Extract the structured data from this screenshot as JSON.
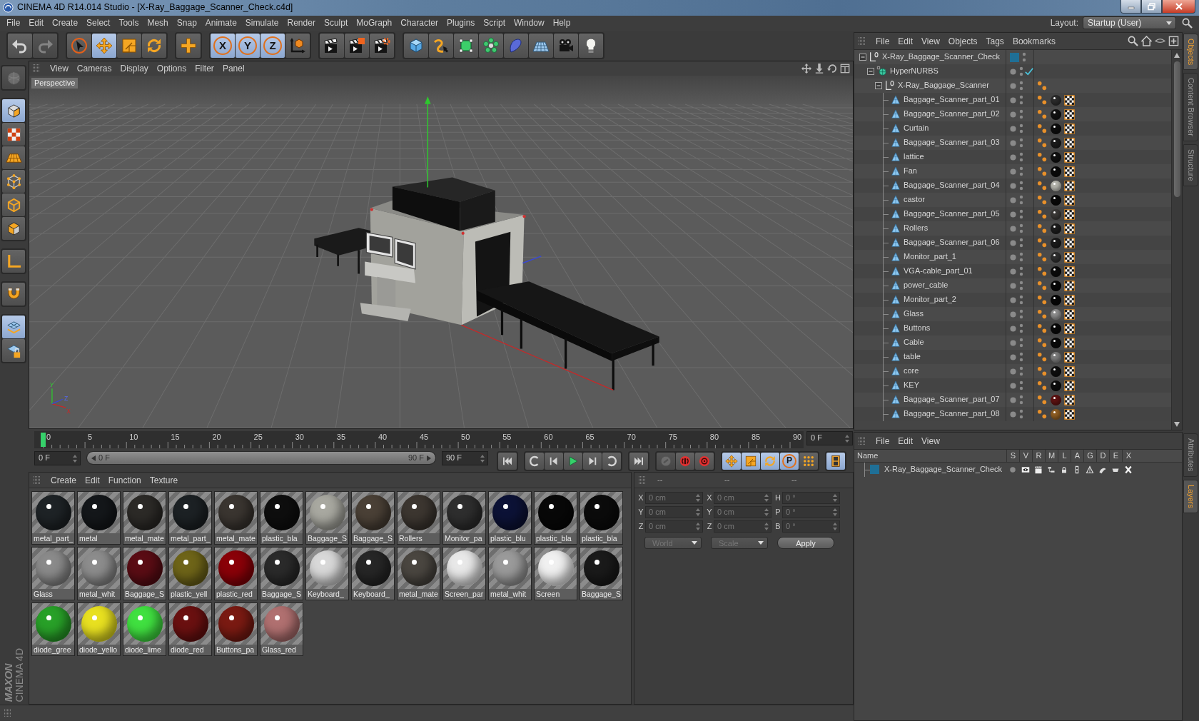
{
  "window": {
    "title": "CINEMA 4D R14.014 Studio - [X-Ray_Baggage_Scanner_Check.c4d]"
  },
  "menu": [
    "File",
    "Edit",
    "Create",
    "Select",
    "Tools",
    "Mesh",
    "Snap",
    "Animate",
    "Simulate",
    "Render",
    "Sculpt",
    "MoGraph",
    "Character",
    "Plugins",
    "Script",
    "Window",
    "Help"
  ],
  "layout": {
    "label": "Layout:",
    "value": "Startup (User)"
  },
  "toolbar": [
    [
      {
        "kind": "undo",
        "selected": false,
        "disabled": false
      },
      {
        "kind": "redo",
        "selected": false,
        "disabled": true
      }
    ],
    [
      {
        "kind": "select",
        "selected": false,
        "disabled": false
      },
      {
        "kind": "move",
        "selected": true,
        "disabled": false
      },
      {
        "kind": "scale",
        "selected": false,
        "disabled": false
      },
      {
        "kind": "rotate",
        "selected": false,
        "disabled": false
      }
    ],
    [
      {
        "kind": "add",
        "selected": false,
        "disabled": false
      }
    ],
    [
      {
        "kind": "axis",
        "label": "X",
        "selected": true,
        "disabled": false
      },
      {
        "kind": "axis",
        "label": "Y",
        "selected": true,
        "disabled": false
      },
      {
        "kind": "axis",
        "label": "Z",
        "selected": true,
        "disabled": false
      },
      {
        "kind": "coordsys",
        "selected": false,
        "disabled": false
      }
    ],
    [
      {
        "kind": "rview",
        "selected": false,
        "disabled": false
      },
      {
        "kind": "rpv",
        "selected": false,
        "disabled": false
      },
      {
        "kind": "rset",
        "selected": false,
        "disabled": false
      }
    ],
    [
      {
        "kind": "cube",
        "selected": false,
        "disabled": false
      },
      {
        "kind": "spline",
        "selected": false,
        "disabled": false
      },
      {
        "kind": "nurbs",
        "selected": false,
        "disabled": false
      },
      {
        "kind": "array",
        "selected": false,
        "disabled": false
      },
      {
        "kind": "deformer",
        "selected": false,
        "disabled": false
      },
      {
        "kind": "floor",
        "selected": false,
        "disabled": false
      },
      {
        "kind": "camera",
        "selected": false,
        "disabled": false
      },
      {
        "kind": "light",
        "selected": false,
        "disabled": false
      }
    ]
  ],
  "left_tools": [
    [
      {
        "kind": "model",
        "selected": false,
        "disabled": true
      }
    ],
    [
      {
        "kind": "object",
        "selected": true,
        "disabled": false
      },
      {
        "kind": "texture",
        "selected": false,
        "disabled": false
      },
      {
        "kind": "workplane",
        "selected": false,
        "disabled": false
      },
      {
        "kind": "points",
        "selected": false,
        "disabled": false
      },
      {
        "kind": "edges",
        "selected": false,
        "disabled": false
      },
      {
        "kind": "polygons",
        "selected": false,
        "disabled": false
      }
    ],
    [
      {
        "kind": "axismode",
        "selected": false,
        "disabled": false
      }
    ],
    [
      {
        "kind": "tweak",
        "selected": false,
        "disabled": false
      }
    ],
    [
      {
        "kind": "wgrid",
        "selected": true,
        "disabled": false
      },
      {
        "kind": "glock",
        "selected": false,
        "disabled": false
      }
    ]
  ],
  "viewport": {
    "menu": [
      "View",
      "Cameras",
      "Display",
      "Options",
      "Filter",
      "Panel"
    ],
    "view_name": "Perspective",
    "axis_labels": [
      "Y",
      "X",
      "Z"
    ]
  },
  "timeline": {
    "frames": [
      "0",
      "5",
      "10",
      "15",
      "20",
      "25",
      "30",
      "35",
      "40",
      "45",
      "50",
      "55",
      "60",
      "65",
      "70",
      "75",
      "80",
      "85",
      "90"
    ],
    "playhead": {
      "level": 0
    },
    "current": "0 F"
  },
  "transport": {
    "start": "0 F",
    "range": {
      "start": "0 F",
      "end": "90 F",
      "level": 1
    },
    "end": "90 F",
    "buttons": [
      [
        {
          "kind": "first",
          "selected": false,
          "disabled": false
        }
      ],
      [
        {
          "kind": "prevkey",
          "selected": false,
          "disabled": false
        },
        {
          "kind": "prevframe",
          "selected": false,
          "disabled": false
        },
        {
          "kind": "play",
          "selected": false,
          "disabled": false
        },
        {
          "kind": "nextframe",
          "selected": false,
          "disabled": false
        },
        {
          "kind": "nextkey",
          "selected": false,
          "disabled": false
        }
      ],
      [
        {
          "kind": "last",
          "selected": false,
          "disabled": false
        }
      ],
      [
        {
          "kind": "recoff",
          "selected": false,
          "disabled": true
        },
        {
          "kind": "record",
          "selected": false,
          "disabled": false
        },
        {
          "kind": "autokey",
          "selected": false,
          "disabled": false
        }
      ],
      [
        {
          "kind": "kmove",
          "selected": true,
          "disabled": false
        },
        {
          "kind": "kscale",
          "selected": true,
          "disabled": false
        },
        {
          "kind": "krot",
          "selected": true,
          "disabled": false
        },
        {
          "kind": "param",
          "label": "P",
          "selected": true,
          "disabled": false
        },
        {
          "kind": "pla",
          "selected": false,
          "disabled": false
        }
      ],
      [
        {
          "kind": "timeline",
          "selected": true,
          "disabled": false
        }
      ]
    ]
  },
  "materials": {
    "menu": [
      "Create",
      "Edit",
      "Function",
      "Texture"
    ],
    "items": [
      {
        "name": "metal_part_",
        "color": "#1e2326"
      },
      {
        "name": "metal",
        "color": "#14171a"
      },
      {
        "name": "metal_mate",
        "color": "#2c2a27"
      },
      {
        "name": "metal_part_",
        "color": "#1c2124"
      },
      {
        "name": "metal_mate",
        "color": "#3a3530"
      },
      {
        "name": "plastic_bla",
        "color": "#0e0e0e"
      },
      {
        "name": "Baggage_S",
        "color": "#a8a8a0"
      },
      {
        "name": "Baggage_S",
        "color": "#4a4036"
      },
      {
        "name": "Rollers",
        "color": "#3c3630"
      },
      {
        "name": "Monitor_pa",
        "color": "#2e2e2e"
      },
      {
        "name": "plastic_blu",
        "color": "#0c1236"
      },
      {
        "name": "plastic_bla",
        "color": "#080808"
      },
      {
        "name": "plastic_bla",
        "color": "#0b0b0b"
      },
      {
        "name": "Glass",
        "color": "#8a8a8a"
      },
      {
        "name": "metal_whit",
        "color": "#8c8c8c"
      },
      {
        "name": "Baggage_S",
        "color": "#5a0c14"
      },
      {
        "name": "plastic_yell",
        "color": "#6e6418"
      },
      {
        "name": "plastic_red",
        "color": "#8a0008"
      },
      {
        "name": "Baggage_S",
        "color": "#2a2a2a"
      },
      {
        "name": "Keyboard_",
        "color": "#d8d8d8"
      },
      {
        "name": "Keyboard_",
        "color": "#262626"
      },
      {
        "name": "metal_mate",
        "color": "#4a4640"
      },
      {
        "name": "Screen_par",
        "color": "#e8e8e8"
      },
      {
        "name": "metal_whit",
        "color": "#9a9a9a"
      },
      {
        "name": "Screen",
        "color": "#f0f0f0"
      },
      {
        "name": "Baggage_S",
        "color": "#1a1a1a"
      },
      {
        "name": "diode_gree",
        "color": "#28a028"
      },
      {
        "name": "diode_yello",
        "color": "#e8e020"
      },
      {
        "name": "diode_lime",
        "color": "#40e040"
      },
      {
        "name": "diode_red",
        "color": "#6a1010"
      },
      {
        "name": "Buttons_pa",
        "color": "#7a1a12"
      },
      {
        "name": "Glass_red",
        "color": "#b07070"
      }
    ]
  },
  "coordinates": {
    "headings": [
      "--",
      "--",
      "--"
    ],
    "disabled": true,
    "rows": [
      [
        {
          "axis": "X",
          "value": "0 cm"
        },
        {
          "axis": "X",
          "value": "0 cm"
        },
        {
          "axis": "H",
          "value": "0 °"
        }
      ],
      [
        {
          "axis": "Y",
          "value": "0 cm"
        },
        {
          "axis": "Y",
          "value": "0 cm"
        },
        {
          "axis": "P",
          "value": "0 °"
        }
      ],
      [
        {
          "axis": "Z",
          "value": "0 cm"
        },
        {
          "axis": "Z",
          "value": "0 cm"
        },
        {
          "axis": "B",
          "value": "0 °"
        }
      ]
    ],
    "mode": "World",
    "transform": "Scale",
    "apply": "Apply"
  },
  "logo": {
    "brand": "MAXON",
    "product": "CINEMA 4D"
  },
  "object_manager": {
    "menu": [
      "File",
      "Edit",
      "View",
      "Objects",
      "Tags",
      "Bookmarks"
    ],
    "tree": [
      {
        "name": "X-Ray_Baggage_Scanner_Check",
        "kind": "null",
        "expanded": true,
        "color": "#1f6f96",
        "children": [
          {
            "name": "HyperNURBS",
            "kind": "nurbs",
            "expanded": true,
            "enabled": true,
            "children": [
              {
                "name": "X-Ray_Baggage_Scanner",
                "kind": "null",
                "expanded": true,
                "tags": [
                  {
                    "kind": "phong"
                  }
                ],
                "children": [
                  {
                    "name": "Baggage_Scanner_part_01",
                    "kind": "polygon",
                    "tags": [
                      {
                        "kind": "phong"
                      },
                      {
                        "kind": "material",
                        "color": "#2b2b2b"
                      },
                      {
                        "kind": "uvw"
                      }
                    ]
                  },
                  {
                    "name": "Baggage_Scanner_part_02",
                    "kind": "polygon",
                    "tags": [
                      {
                        "kind": "phong"
                      },
                      {
                        "kind": "material",
                        "color": "#121212"
                      },
                      {
                        "kind": "uvw"
                      }
                    ]
                  },
                  {
                    "name": "Curtain",
                    "kind": "polygon",
                    "tags": [
                      {
                        "kind": "phong"
                      },
                      {
                        "kind": "material",
                        "color": "#0d0d0d"
                      },
                      {
                        "kind": "uvw"
                      }
                    ]
                  },
                  {
                    "name": "Baggage_Scanner_part_03",
                    "kind": "polygon",
                    "tags": [
                      {
                        "kind": "phong"
                      },
                      {
                        "kind": "material",
                        "color": "#1b1b1b"
                      },
                      {
                        "kind": "uvw"
                      }
                    ]
                  },
                  {
                    "name": "lattice",
                    "kind": "polygon",
                    "tags": [
                      {
                        "kind": "phong"
                      },
                      {
                        "kind": "material",
                        "color": "#101010"
                      },
                      {
                        "kind": "uvw"
                      }
                    ]
                  },
                  {
                    "name": "Fan",
                    "kind": "polygon",
                    "tags": [
                      {
                        "kind": "phong"
                      },
                      {
                        "kind": "material",
                        "color": "#0a0a0a"
                      },
                      {
                        "kind": "uvw"
                      }
                    ]
                  },
                  {
                    "name": "Baggage_Scanner_part_04",
                    "kind": "polygon",
                    "tags": [
                      {
                        "kind": "phong"
                      },
                      {
                        "kind": "material",
                        "color": "#b4b4ac"
                      },
                      {
                        "kind": "uvw"
                      }
                    ]
                  },
                  {
                    "name": "castor",
                    "kind": "polygon",
                    "tags": [
                      {
                        "kind": "phong"
                      },
                      {
                        "kind": "material",
                        "color": "#090909"
                      },
                      {
                        "kind": "uvw"
                      }
                    ]
                  },
                  {
                    "name": "Baggage_Scanner_part_05",
                    "kind": "polygon",
                    "tags": [
                      {
                        "kind": "phong"
                      },
                      {
                        "kind": "material",
                        "color": "#3a3836"
                      },
                      {
                        "kind": "uvw"
                      }
                    ]
                  },
                  {
                    "name": "Rollers",
                    "kind": "polygon",
                    "tags": [
                      {
                        "kind": "phong"
                      },
                      {
                        "kind": "material",
                        "color": "#1c1c1c"
                      },
                      {
                        "kind": "uvw"
                      }
                    ]
                  },
                  {
                    "name": "Baggage_Scanner_part_06",
                    "kind": "polygon",
                    "tags": [
                      {
                        "kind": "phong"
                      },
                      {
                        "kind": "material",
                        "color": "#1a1a1a"
                      },
                      {
                        "kind": "uvw"
                      }
                    ]
                  },
                  {
                    "name": "Monitor_part_1",
                    "kind": "polygon",
                    "tags": [
                      {
                        "kind": "phong"
                      },
                      {
                        "kind": "material",
                        "color": "#2e2e2e"
                      },
                      {
                        "kind": "uvw"
                      }
                    ]
                  },
                  {
                    "name": "VGA-cable_part_01",
                    "kind": "polygon",
                    "tags": [
                      {
                        "kind": "phong"
                      },
                      {
                        "kind": "material",
                        "color": "#0b0b0b"
                      },
                      {
                        "kind": "uvw"
                      }
                    ]
                  },
                  {
                    "name": "power_cable",
                    "kind": "polygon",
                    "tags": [
                      {
                        "kind": "phong"
                      },
                      {
                        "kind": "material",
                        "color": "#080808"
                      },
                      {
                        "kind": "uvw"
                      }
                    ]
                  },
                  {
                    "name": "Monitor_part_2",
                    "kind": "polygon",
                    "tags": [
                      {
                        "kind": "phong"
                      },
                      {
                        "kind": "material",
                        "color": "#070707"
                      },
                      {
                        "kind": "uvw"
                      }
                    ]
                  },
                  {
                    "name": "Glass",
                    "kind": "polygon",
                    "tags": [
                      {
                        "kind": "phong"
                      },
                      {
                        "kind": "material",
                        "color": "#8c8c8c"
                      },
                      {
                        "kind": "uvw"
                      }
                    ]
                  },
                  {
                    "name": "Buttons",
                    "kind": "polygon",
                    "tags": [
                      {
                        "kind": "phong"
                      },
                      {
                        "kind": "material",
                        "color": "#090909"
                      },
                      {
                        "kind": "uvw"
                      }
                    ]
                  },
                  {
                    "name": "Cable",
                    "kind": "polygon",
                    "tags": [
                      {
                        "kind": "phong"
                      },
                      {
                        "kind": "material",
                        "color": "#0a0a0a"
                      },
                      {
                        "kind": "uvw"
                      }
                    ]
                  },
                  {
                    "name": "table",
                    "kind": "polygon",
                    "tags": [
                      {
                        "kind": "phong"
                      },
                      {
                        "kind": "material",
                        "color": "#7c7c7c"
                      },
                      {
                        "kind": "uvw"
                      }
                    ]
                  },
                  {
                    "name": "core",
                    "kind": "polygon",
                    "tags": [
                      {
                        "kind": "phong"
                      },
                      {
                        "kind": "material",
                        "color": "#0e0e0e"
                      },
                      {
                        "kind": "uvw"
                      }
                    ]
                  },
                  {
                    "name": "KEY",
                    "kind": "polygon",
                    "tags": [
                      {
                        "kind": "phong"
                      },
                      {
                        "kind": "material",
                        "color": "#0d0d0d"
                      },
                      {
                        "kind": "uvw"
                      }
                    ]
                  },
                  {
                    "name": "Baggage_Scanner_part_07",
                    "kind": "polygon",
                    "tags": [
                      {
                        "kind": "phong"
                      },
                      {
                        "kind": "material",
                        "color": "#5c1212"
                      },
                      {
                        "kind": "uvw"
                      }
                    ]
                  },
                  {
                    "name": "Baggage_Scanner_part_08",
                    "kind": "polygon",
                    "tags": [
                      {
                        "kind": "phong"
                      },
                      {
                        "kind": "material",
                        "color": "#8c5c22"
                      },
                      {
                        "kind": "uvw"
                      }
                    ]
                  }
                ]
              }
            ]
          }
        ]
      }
    ]
  },
  "object_tabs": [
    {
      "label": "Objects",
      "selected": true
    },
    {
      "label": "Content Browser",
      "selected": false
    },
    {
      "label": "Structure",
      "selected": false
    }
  ],
  "layers": {
    "menu": [
      "File",
      "Edit",
      "View"
    ],
    "columns": [
      "Name",
      "S",
      "V",
      "R",
      "M",
      "L",
      "A",
      "G",
      "D",
      "E",
      "X"
    ],
    "rows": [
      {
        "name": "X-Ray_Baggage_Scanner_Check",
        "color": "#1f6f96"
      }
    ]
  },
  "layer_tabs": [
    {
      "label": "Attributes",
      "selected": false
    },
    {
      "label": "Layers",
      "selected": true
    }
  ]
}
